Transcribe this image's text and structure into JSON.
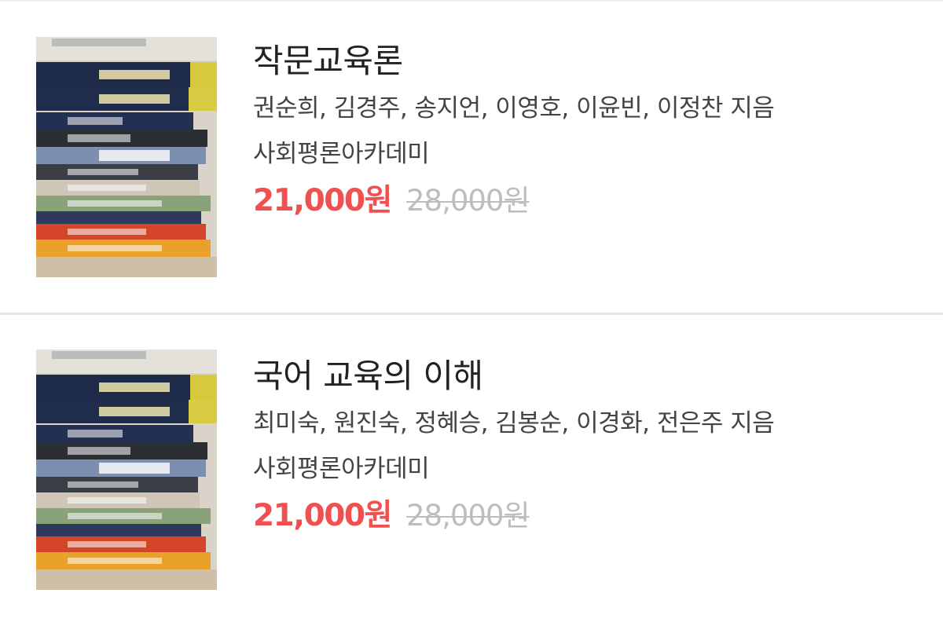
{
  "books": [
    {
      "title": "작문교육론",
      "authors": "권순희, 김경주, 송지언, 이영호, 이윤빈, 이정찬 지음",
      "publisher": "사회평론아카데미",
      "price": "21,000원",
      "original_price": "28,000원"
    },
    {
      "title": "국어 교육의 이해",
      "authors": "최미숙, 원진숙, 정혜승, 김봉순, 이경화, 전은주 지음",
      "publisher": "사회평론아카데미",
      "price": "21,000원",
      "original_price": "28,000원"
    }
  ],
  "colors": {
    "price": "#f0504f",
    "original_price": "#bdbdbd",
    "divider": "#e6e6e6"
  },
  "icons": {
    "thumbnail": "book-stack-photo"
  }
}
